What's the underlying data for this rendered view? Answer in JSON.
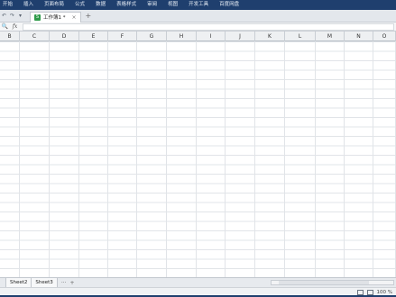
{
  "menu": [
    "开始",
    "插入",
    "页面布局",
    "公式",
    "数据",
    "表格样式",
    "审阅",
    "视图",
    "开发工具",
    "百度网盘"
  ],
  "quick_access": [
    "undo-icon",
    "redo-icon",
    "dropdown-icon"
  ],
  "document_tab": {
    "title": "工作簿1 *",
    "close": "×",
    "new_tab": "+"
  },
  "formula_bar": {
    "zoom_icon": "Q",
    "fx": "fx",
    "value": ""
  },
  "columns": [
    "B",
    "C",
    "D",
    "E",
    "F",
    "G",
    "H",
    "I",
    "J",
    "K",
    "L",
    "M",
    "N",
    "O"
  ],
  "sheets": [
    "Sheet2",
    "Sheet3"
  ],
  "sheet_nav": {
    "more": "···",
    "add": "+"
  },
  "status": {
    "zoom": "100 %"
  }
}
